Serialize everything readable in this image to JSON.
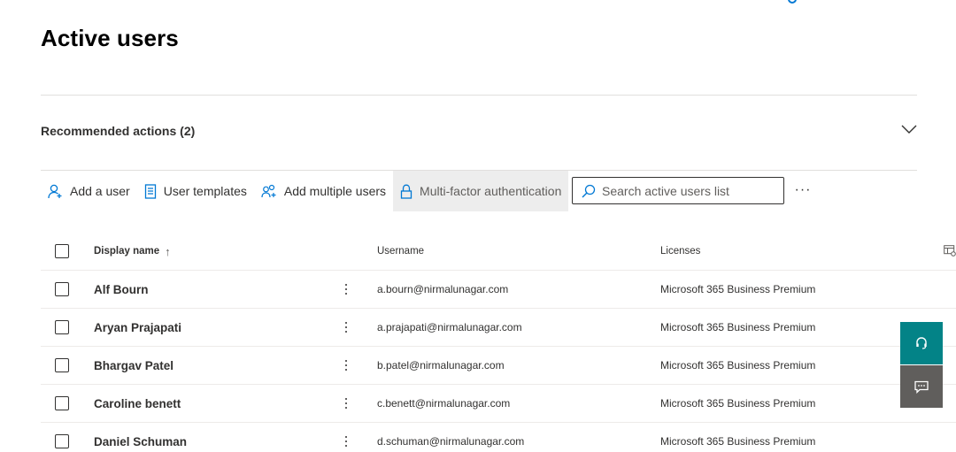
{
  "page": {
    "title": "Active users"
  },
  "recommended": {
    "label": "Recommended actions (2)"
  },
  "toolbar": {
    "add_user": "Add a user",
    "user_templates": "User templates",
    "add_multiple": "Add multiple users",
    "mfa": "Multi-factor authentication",
    "more": "···"
  },
  "search": {
    "placeholder": "Search active users list"
  },
  "table": {
    "headers": {
      "name": "Display name",
      "sort_arrow": "↑",
      "username": "Username",
      "licenses": "Licenses"
    },
    "rows": [
      {
        "name": "Alf Bourn",
        "username": "a.bourn@nirmalunagar.com",
        "license": "Microsoft 365 Business Premium"
      },
      {
        "name": "Aryan Prajapati",
        "username": "a.prajapati@nirmalunagar.com",
        "license": "Microsoft 365 Business Premium"
      },
      {
        "name": "Bhargav Patel",
        "username": "b.patel@nirmalunagar.com",
        "license": "Microsoft 365 Business Premium"
      },
      {
        "name": "Caroline benett",
        "username": "c.benett@nirmalunagar.com",
        "license": "Microsoft 365 Business Premium"
      },
      {
        "name": "Daniel Schuman",
        "username": "d.schuman@nirmalunagar.com",
        "license": "Microsoft 365 Business Premium"
      }
    ]
  },
  "colors": {
    "accent": "#0078d4",
    "help_button": "#038387",
    "feedback_button": "#605e5c"
  },
  "icons": {
    "add_user": "person-add-icon",
    "templates": "document-list-icon",
    "add_multiple": "people-add-icon",
    "mfa": "lock-icon",
    "search": "search-icon",
    "chevron": "chevron-down-icon",
    "column_picker": "column-options-icon",
    "help": "headset-icon",
    "feedback": "chat-feedback-icon"
  }
}
